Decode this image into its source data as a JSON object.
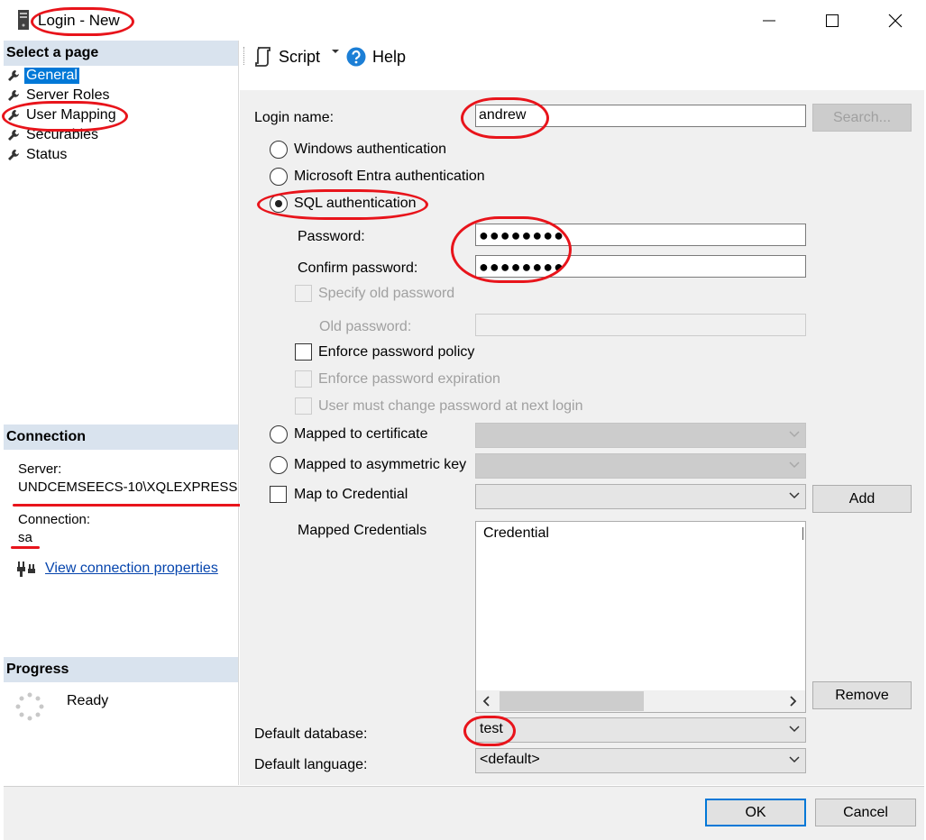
{
  "window": {
    "title": "Login - New"
  },
  "left_pane": {
    "select_page_heading": "Select a page",
    "pages": [
      {
        "label": "General",
        "selected": true
      },
      {
        "label": "Server Roles",
        "selected": false
      },
      {
        "label": "User Mapping",
        "selected": false
      },
      {
        "label": "Securables",
        "selected": false
      },
      {
        "label": "Status",
        "selected": false
      }
    ],
    "connection_heading": "Connection",
    "server_label": "Server:",
    "server_value": "UNDCEMSEECS-10\\XQLEXPRESS",
    "connection_label": "Connection:",
    "connection_value": "sa",
    "view_properties_link": "View connection properties",
    "progress_heading": "Progress",
    "progress_status": "Ready"
  },
  "toolbar": {
    "script_label": "Script",
    "help_label": "Help"
  },
  "general": {
    "login_name_label": "Login name:",
    "login_name_value": "andrew",
    "search_button": "Search...",
    "windows_auth_label": "Windows authentication",
    "entra_auth_label": "Microsoft Entra authentication",
    "sql_auth_label": "SQL authentication",
    "auth_selected": "SQL authentication",
    "password_label": "Password:",
    "password_value": "●●●●●●●●",
    "confirm_password_label": "Confirm password:",
    "confirm_password_value": "●●●●●●●●",
    "specify_old_password_label": "Specify old password",
    "old_password_label": "Old password:",
    "enforce_policy_label": "Enforce password policy",
    "enforce_expiration_label": "Enforce password expiration",
    "must_change_label": "User must change password at next login",
    "mapped_certificate_label": "Mapped to certificate",
    "mapped_asym_key_label": "Mapped to asymmetric key",
    "map_credential_label": "Map to Credential",
    "add_button": "Add",
    "mapped_credentials_label": "Mapped Credentials",
    "credentials_column": "Credential",
    "remove_button": "Remove",
    "default_database_label": "Default database:",
    "default_database_value": "test",
    "default_language_label": "Default language:",
    "default_language_value": "<default>"
  },
  "buttons": {
    "ok": "OK",
    "cancel": "Cancel"
  },
  "colors": {
    "selection": "#0078d7",
    "section_header": "#d9e3ee",
    "panel_bg": "#f0f0f0",
    "annotation_red": "#e8141b",
    "link": "#0645ad"
  }
}
